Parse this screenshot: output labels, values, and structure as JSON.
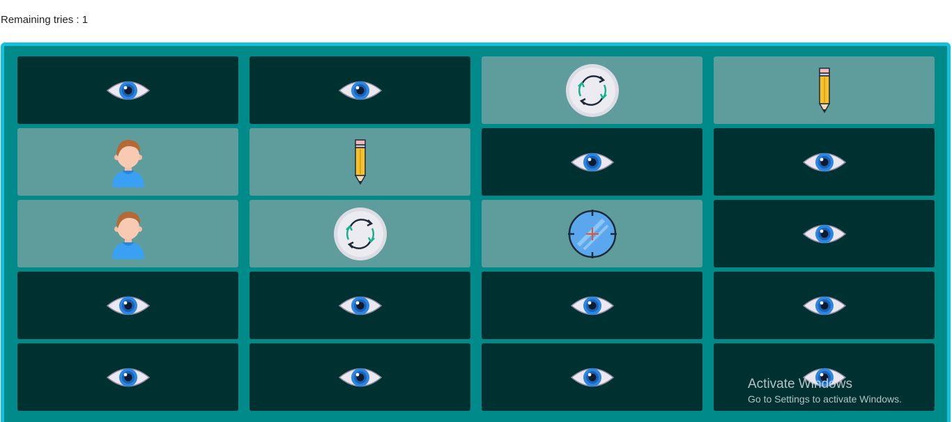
{
  "status": {
    "remaining_tries_text": "Remaining tries : 1"
  },
  "colors": {
    "board": "#008a8a",
    "border": "#13c1dd",
    "hidden_card": "#003131",
    "revealed_card": "#5f9c9c"
  },
  "cards": [
    {
      "state": "hidden",
      "icon": "eye-icon"
    },
    {
      "state": "hidden",
      "icon": "eye-icon"
    },
    {
      "state": "revealed",
      "icon": "refresh-icon"
    },
    {
      "state": "revealed",
      "icon": "pencil-icon"
    },
    {
      "state": "revealed",
      "icon": "user-icon"
    },
    {
      "state": "revealed",
      "icon": "pencil-icon"
    },
    {
      "state": "hidden",
      "icon": "eye-icon"
    },
    {
      "state": "hidden",
      "icon": "eye-icon"
    },
    {
      "state": "revealed",
      "icon": "user-icon"
    },
    {
      "state": "revealed",
      "icon": "refresh-icon"
    },
    {
      "state": "revealed",
      "icon": "crosshair-icon"
    },
    {
      "state": "hidden",
      "icon": "eye-icon"
    },
    {
      "state": "hidden",
      "icon": "eye-icon"
    },
    {
      "state": "hidden",
      "icon": "eye-icon"
    },
    {
      "state": "hidden",
      "icon": "eye-icon"
    },
    {
      "state": "hidden",
      "icon": "eye-icon"
    },
    {
      "state": "hidden",
      "icon": "eye-icon"
    },
    {
      "state": "hidden",
      "icon": "eye-icon"
    },
    {
      "state": "hidden",
      "icon": "eye-icon"
    },
    {
      "state": "hidden",
      "icon": "eye-icon"
    }
  ],
  "watermark": {
    "title": "Activate Windows",
    "subtitle": "Go to Settings to activate Windows."
  }
}
